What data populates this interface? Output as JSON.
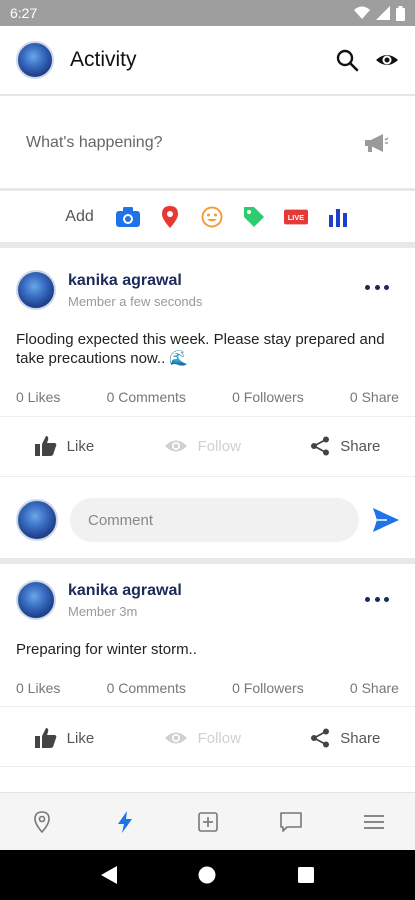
{
  "status_bar": {
    "time": "6:27"
  },
  "header": {
    "title": "Activity",
    "icons": [
      "search-icon",
      "eye-icon"
    ]
  },
  "compose": {
    "placeholder": "What's happening?",
    "icon": "megaphone-icon"
  },
  "add_bar": {
    "label": "Add",
    "icons": [
      {
        "name": "camera-icon",
        "color": "#1e73e8"
      },
      {
        "name": "location-pin-icon",
        "color": "#e53935"
      },
      {
        "name": "emoji-icon",
        "color": "#f39c3d"
      },
      {
        "name": "tag-icon",
        "color": "#2ecc71"
      },
      {
        "name": "live-icon",
        "color": "#e53935",
        "text": "LIVE"
      },
      {
        "name": "poll-icon",
        "color": "#1e40c8"
      }
    ]
  },
  "posts": [
    {
      "author": "kanika agrawal",
      "meta": "Member a few seconds",
      "text": "Flooding expected this week. Please stay prepared and take precautions now.. 🌊",
      "stats": {
        "likes": "0 Likes",
        "comments": "0 Comments",
        "followers": "0 Followers",
        "shares": "0 Share"
      },
      "actions": {
        "like": "Like",
        "follow": "Follow",
        "share": "Share"
      }
    },
    {
      "author": "kanika agrawal",
      "meta": "Member 3m",
      "text": "Preparing for winter storm..",
      "stats": {
        "likes": "0 Likes",
        "comments": "0 Comments",
        "followers": "0 Followers",
        "shares": "0 Share"
      },
      "actions": {
        "like": "Like",
        "follow": "Follow",
        "share": "Share"
      }
    }
  ],
  "comment": {
    "placeholder": "Comment"
  },
  "bottom_nav": {
    "items": [
      "location-icon",
      "activity-bolt-icon",
      "add-post-icon",
      "messages-icon",
      "menu-icon"
    ],
    "active": "activity-bolt-icon",
    "active_color": "#1e73e8"
  },
  "colors": {
    "brand": "#1b2a5a",
    "accent": "#1e73e8"
  }
}
